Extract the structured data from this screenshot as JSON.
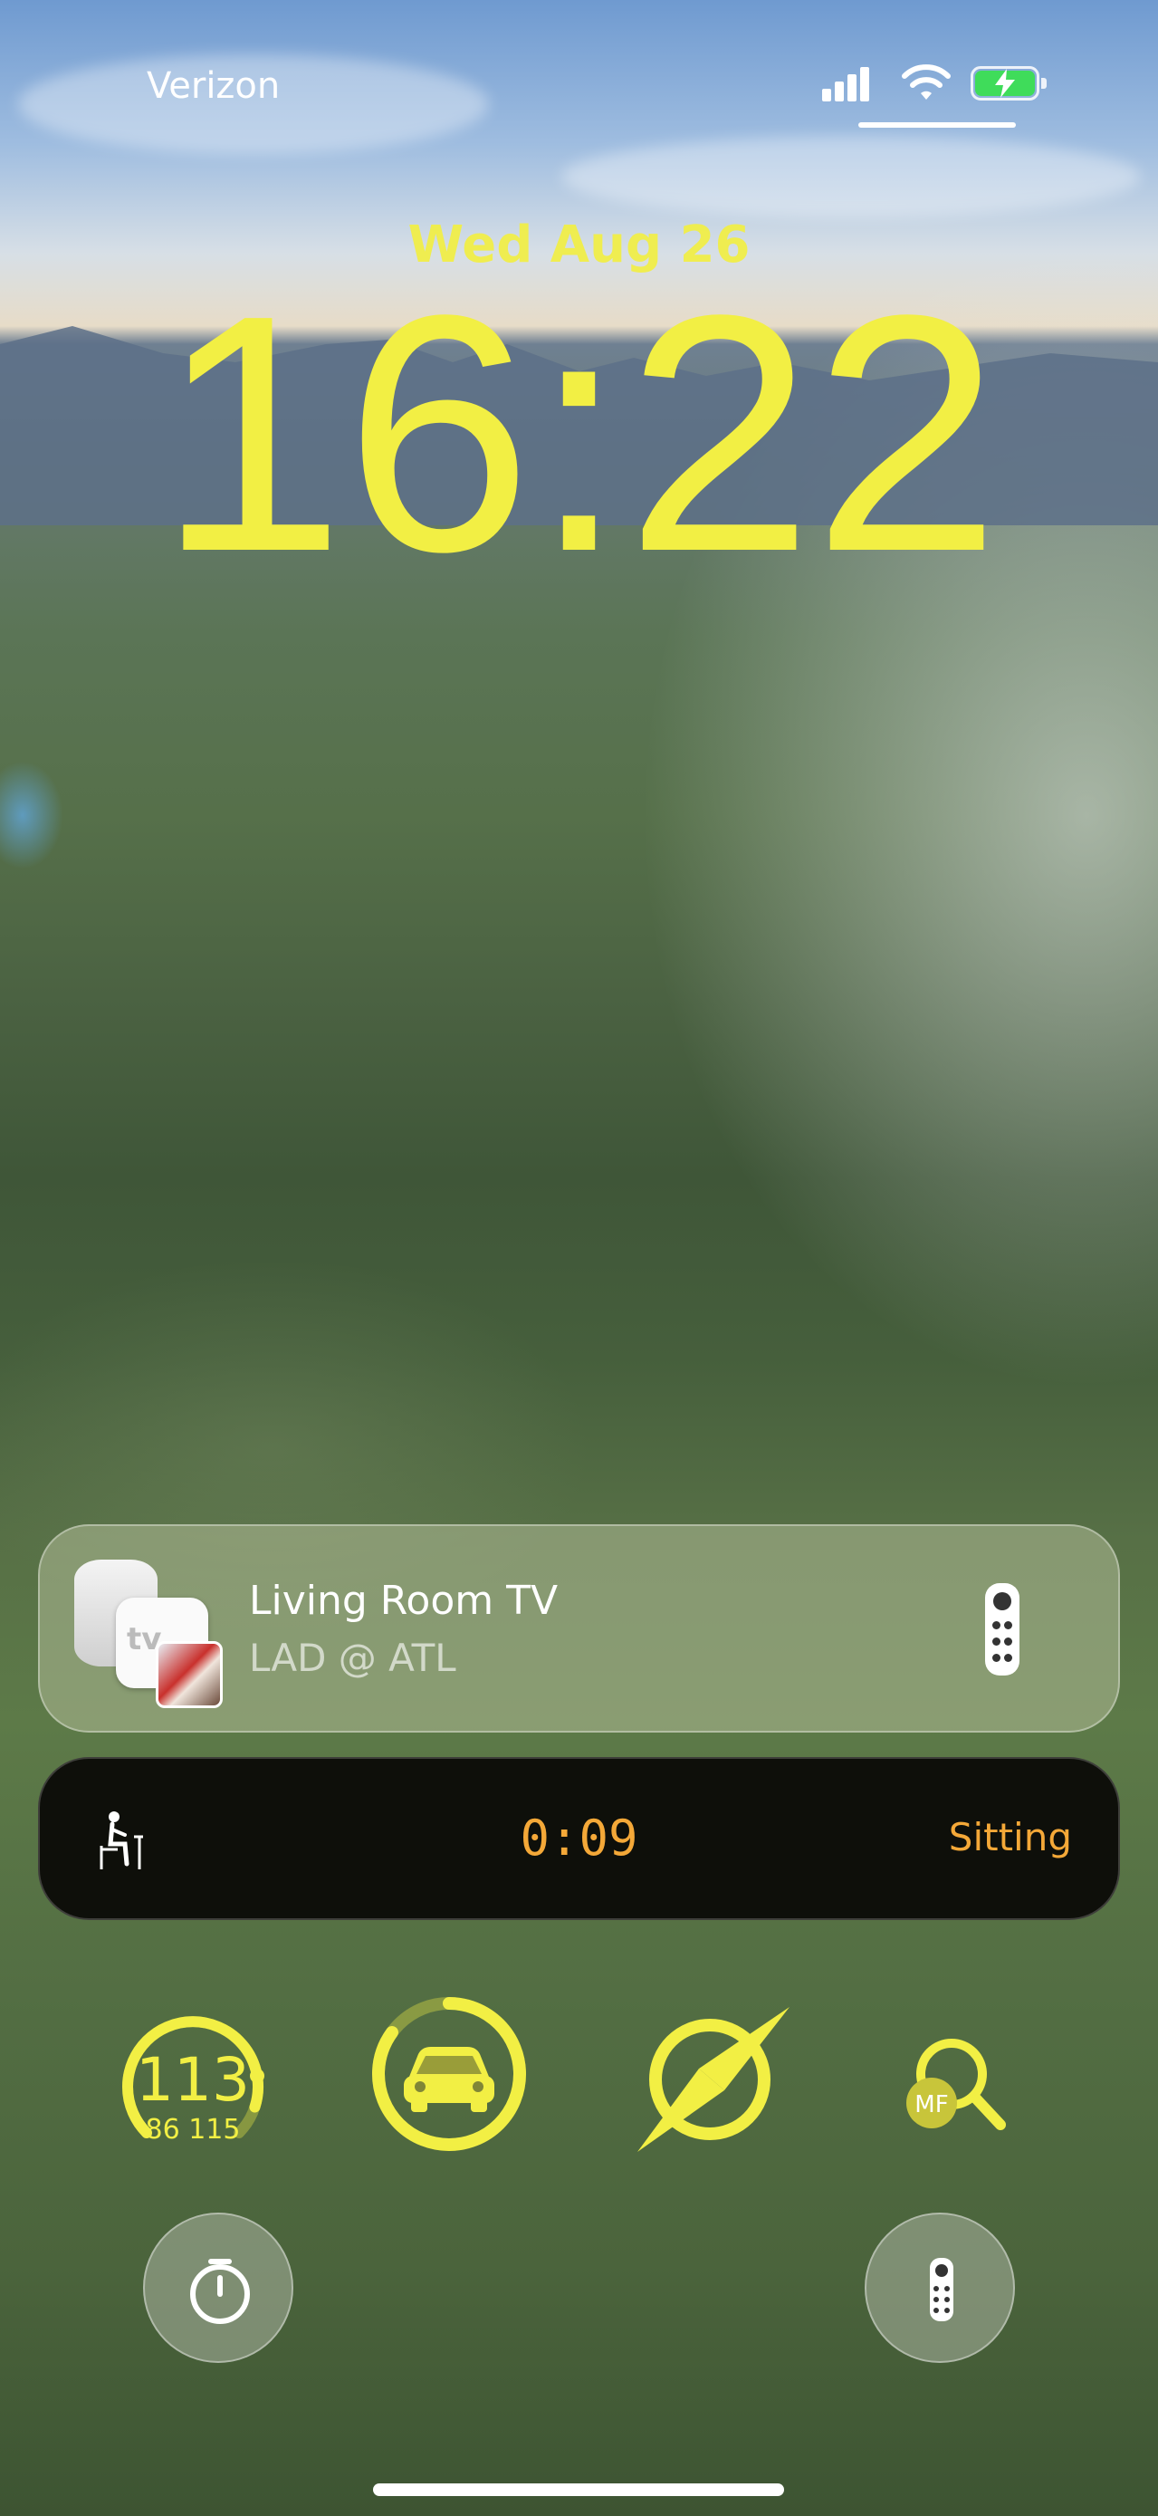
{
  "status_bar": {
    "carrier": "Verizon",
    "icons": [
      "cellular-signal-icon",
      "wifi-icon",
      "battery-charging-icon"
    ],
    "battery_level": 0.9
  },
  "lock_screen": {
    "date": "Wed Aug 26",
    "time": "16:22",
    "accent_color": "#f2ef44"
  },
  "now_playing": {
    "device": "Living Room TV",
    "content": "LAD @ ATL",
    "app_label": "tv",
    "icons": [
      "homepod-icon",
      "apple-tv-icon",
      "remote-icon"
    ]
  },
  "posture_widget": {
    "timer": "0:09",
    "status": "Sitting",
    "accent_color": "#f4a838",
    "icon": "person-sitting-icon"
  },
  "complications": {
    "gauge": {
      "value": "113",
      "min": "86",
      "max": "115",
      "range_text": "86  115",
      "fraction": 0.9
    },
    "car": {
      "icon": "car-icon",
      "fraction": 0.85
    },
    "compass": {
      "icon": "compass-icon"
    },
    "search": {
      "icon": "magnifier-icon",
      "badge": "MF"
    }
  },
  "quick_actions": {
    "left_icon": "stopwatch-icon",
    "right_icon": "remote-icon"
  }
}
